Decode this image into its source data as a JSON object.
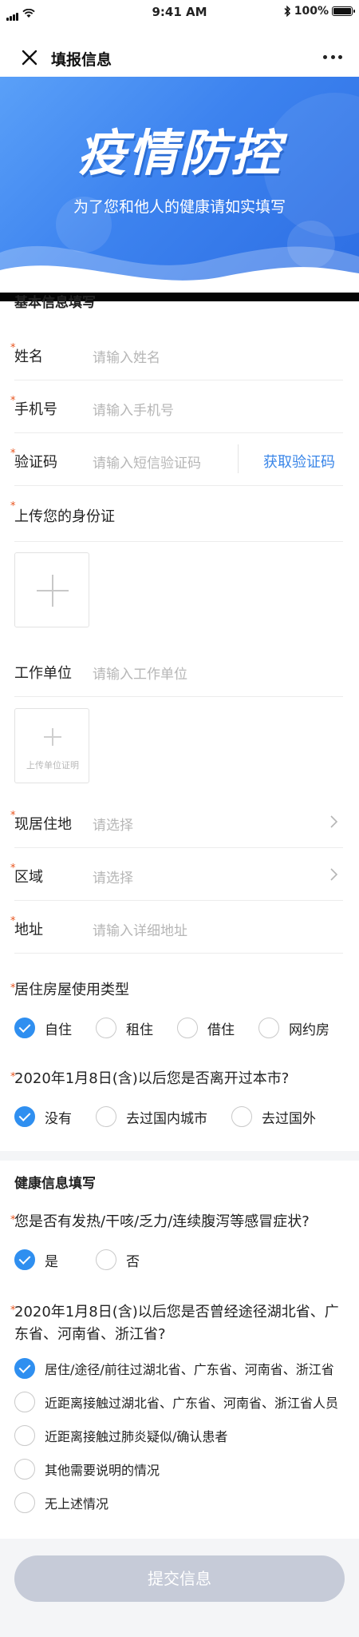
{
  "status_bar": {
    "time": "9:41 AM",
    "battery": "100%"
  },
  "nav": {
    "title": "填报信息"
  },
  "banner": {
    "title": "疫情防控",
    "subtitle": "为了您和他人的健康请如实填写"
  },
  "sections": {
    "basic": "基本信息填写",
    "health": "健康信息填写"
  },
  "fields": {
    "name": {
      "label": "姓名",
      "placeholder": "请输入姓名"
    },
    "phone": {
      "label": "手机号",
      "placeholder": "请输入手机号"
    },
    "code": {
      "label": "验证码",
      "placeholder": "请输入短信验证码",
      "button": "获取验证码"
    },
    "id_upload": {
      "label": "上传您的身份证"
    },
    "work": {
      "label": "工作单位",
      "placeholder": "请输入工作单位",
      "upload_caption": "上传单位证明"
    },
    "residence": {
      "label": "现居住地",
      "placeholder": "请选择"
    },
    "area": {
      "label": "区域",
      "placeholder": "请选择"
    },
    "address": {
      "label": "地址",
      "placeholder": "请输入详细地址"
    }
  },
  "questions": {
    "housing": {
      "label": "居住房屋使用类型",
      "options": [
        "自住",
        "租住",
        "借住",
        "网约房"
      ],
      "selected": "自住"
    },
    "left_city": {
      "label": "2020年1月8日(含)以后您是否离开过本市?",
      "options": [
        "没有",
        "去过国内城市",
        "去过国外"
      ],
      "selected": "没有"
    },
    "symptoms": {
      "label": "您是否有发热/干咳/乏力/连续腹泻等感冒症状?",
      "options": [
        "是",
        "否"
      ],
      "selected": "是"
    },
    "hubei": {
      "label": "2020年1月8日(含)以后您是否曾经途径湖北省、广东省、河南省、浙江省?",
      "options": [
        "居住/途径/前往过湖北省、广东省、河南省、浙江省",
        "近距离接触过湖北省、广东省、河南省、浙江省人员",
        "近距离接触过肺炎疑似/确认患者",
        "其他需要说明的情况",
        "无上述情况"
      ],
      "selected": "居住/途径/前往过湖北省、广东省、河南省、浙江省"
    }
  },
  "submit": {
    "label": "提交信息"
  },
  "required_mark": "*",
  "colors": {
    "accent": "#2f8ff0",
    "link": "#3a86e8",
    "required": "#e8541e",
    "submit_disabled": "#c6cbd8"
  }
}
